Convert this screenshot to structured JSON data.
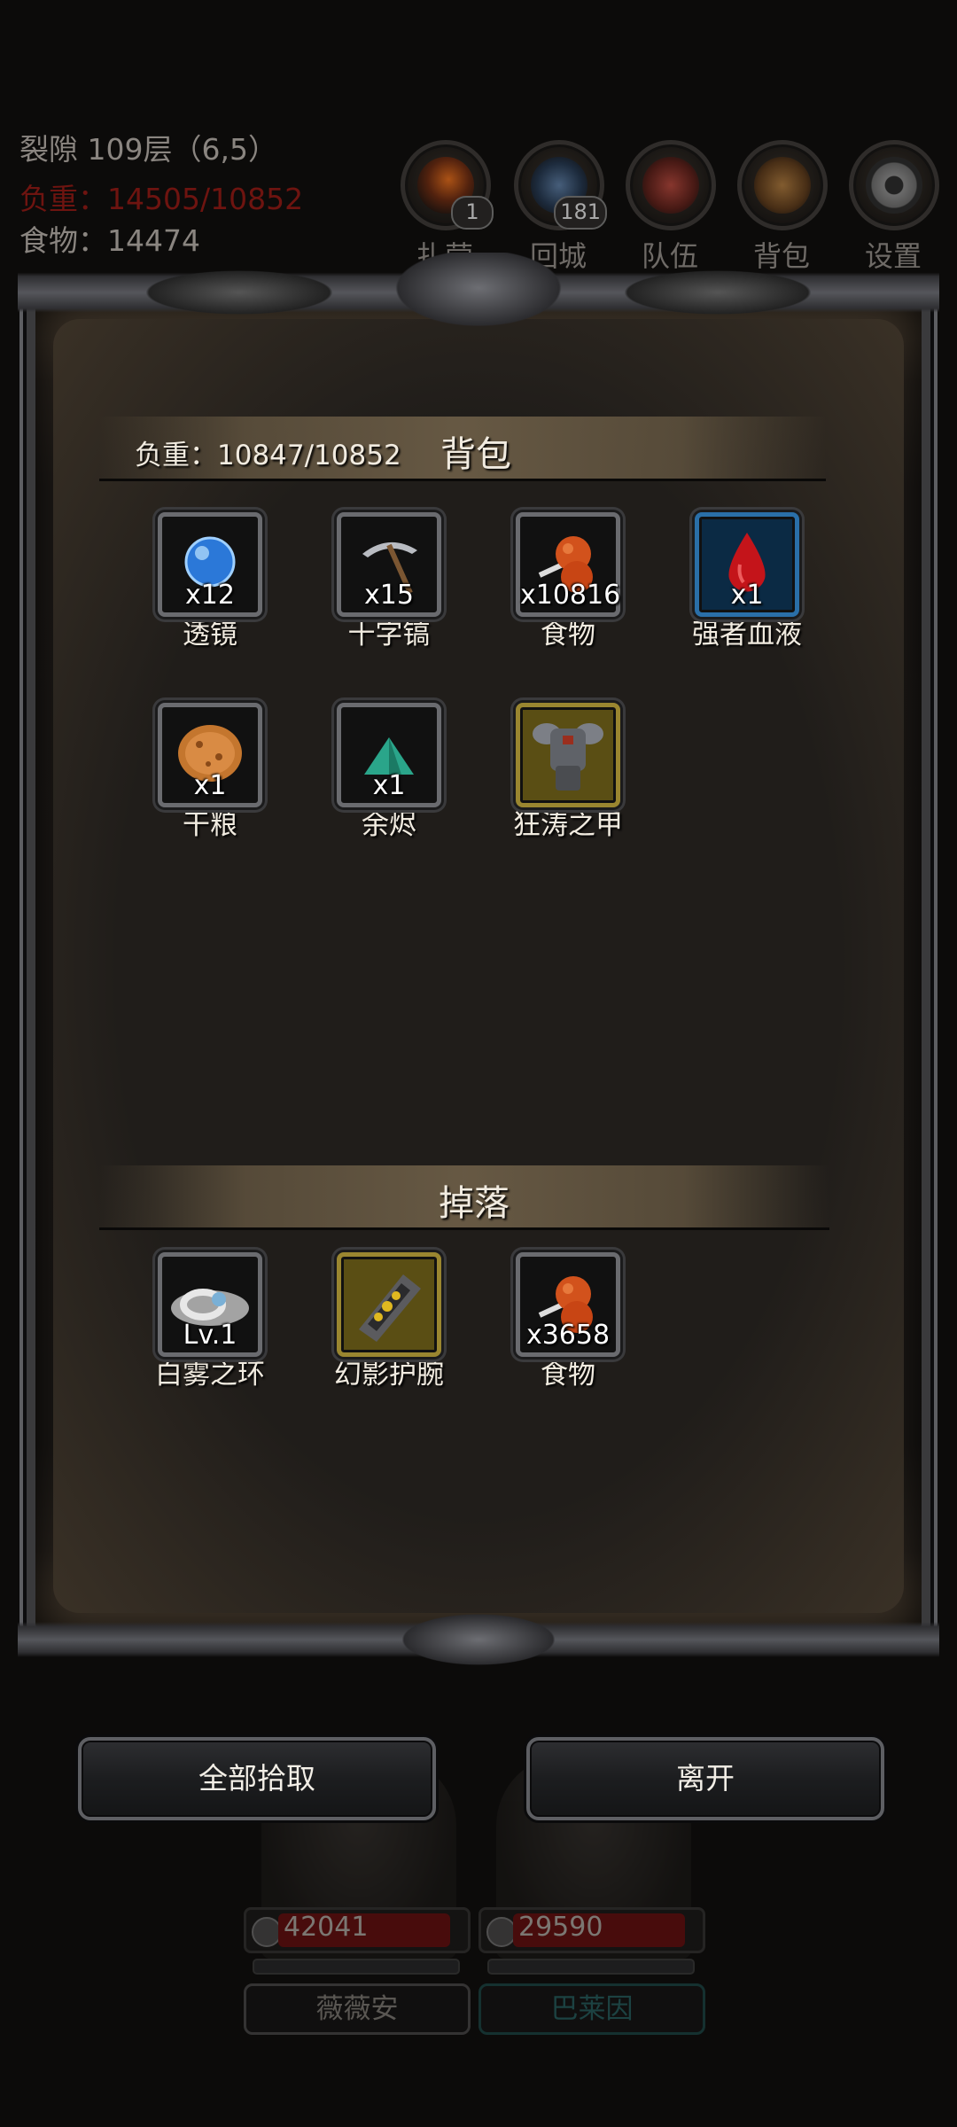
{
  "hud": {
    "floor": "裂隙 109层（6,5）",
    "load": "负重：14505/10852",
    "food": "食物：14474",
    "buttons": [
      {
        "label": "扎营",
        "badge": "1",
        "icon": "camp-icon"
      },
      {
        "label": "回城",
        "badge": "181",
        "icon": "portal-icon"
      },
      {
        "label": "队伍",
        "badge": "",
        "icon": "team-icon"
      },
      {
        "label": "背包",
        "badge": "",
        "icon": "backpack-icon"
      },
      {
        "label": "设置",
        "badge": "",
        "icon": "gear-icon"
      }
    ]
  },
  "bag": {
    "title": "背包",
    "load": "负重：10847/10852",
    "items": [
      {
        "name": "透镜",
        "qty": "x12",
        "icon": "lens-icon"
      },
      {
        "name": "十字镐",
        "qty": "x15",
        "icon": "pickaxe-icon"
      },
      {
        "name": "食物",
        "qty": "x10816",
        "icon": "meat-icon"
      },
      {
        "name": "强者血液",
        "qty": "x1",
        "icon": "blood-drop-icon"
      },
      {
        "name": "干粮",
        "qty": "x1",
        "icon": "ration-icon"
      },
      {
        "name": "余烬",
        "qty": "x1",
        "icon": "ember-icon"
      },
      {
        "name": "狂涛之甲",
        "qty": "",
        "icon": "armor-icon"
      }
    ]
  },
  "drop": {
    "title": "掉落",
    "items": [
      {
        "name": "白雾之环",
        "qty": "Lv.1",
        "icon": "ring-icon"
      },
      {
        "name": "幻影护腕",
        "qty": "",
        "icon": "bracer-icon"
      },
      {
        "name": "食物",
        "qty": "x3658",
        "icon": "meat-icon"
      }
    ]
  },
  "actions": {
    "pickup_all": "全部拾取",
    "leave": "离开"
  },
  "heroes": [
    {
      "name": "薇薇安",
      "hp": "42041",
      "hp_fraction": 0.95
    },
    {
      "name": "巴莱因",
      "hp": "29590",
      "hp_fraction": 0.95
    }
  ],
  "colors": {
    "overload_red": "#6e1410",
    "blood_red": "#c4141a",
    "lens_blue": "#2b78d8",
    "epic_gold": "#9a8630"
  }
}
